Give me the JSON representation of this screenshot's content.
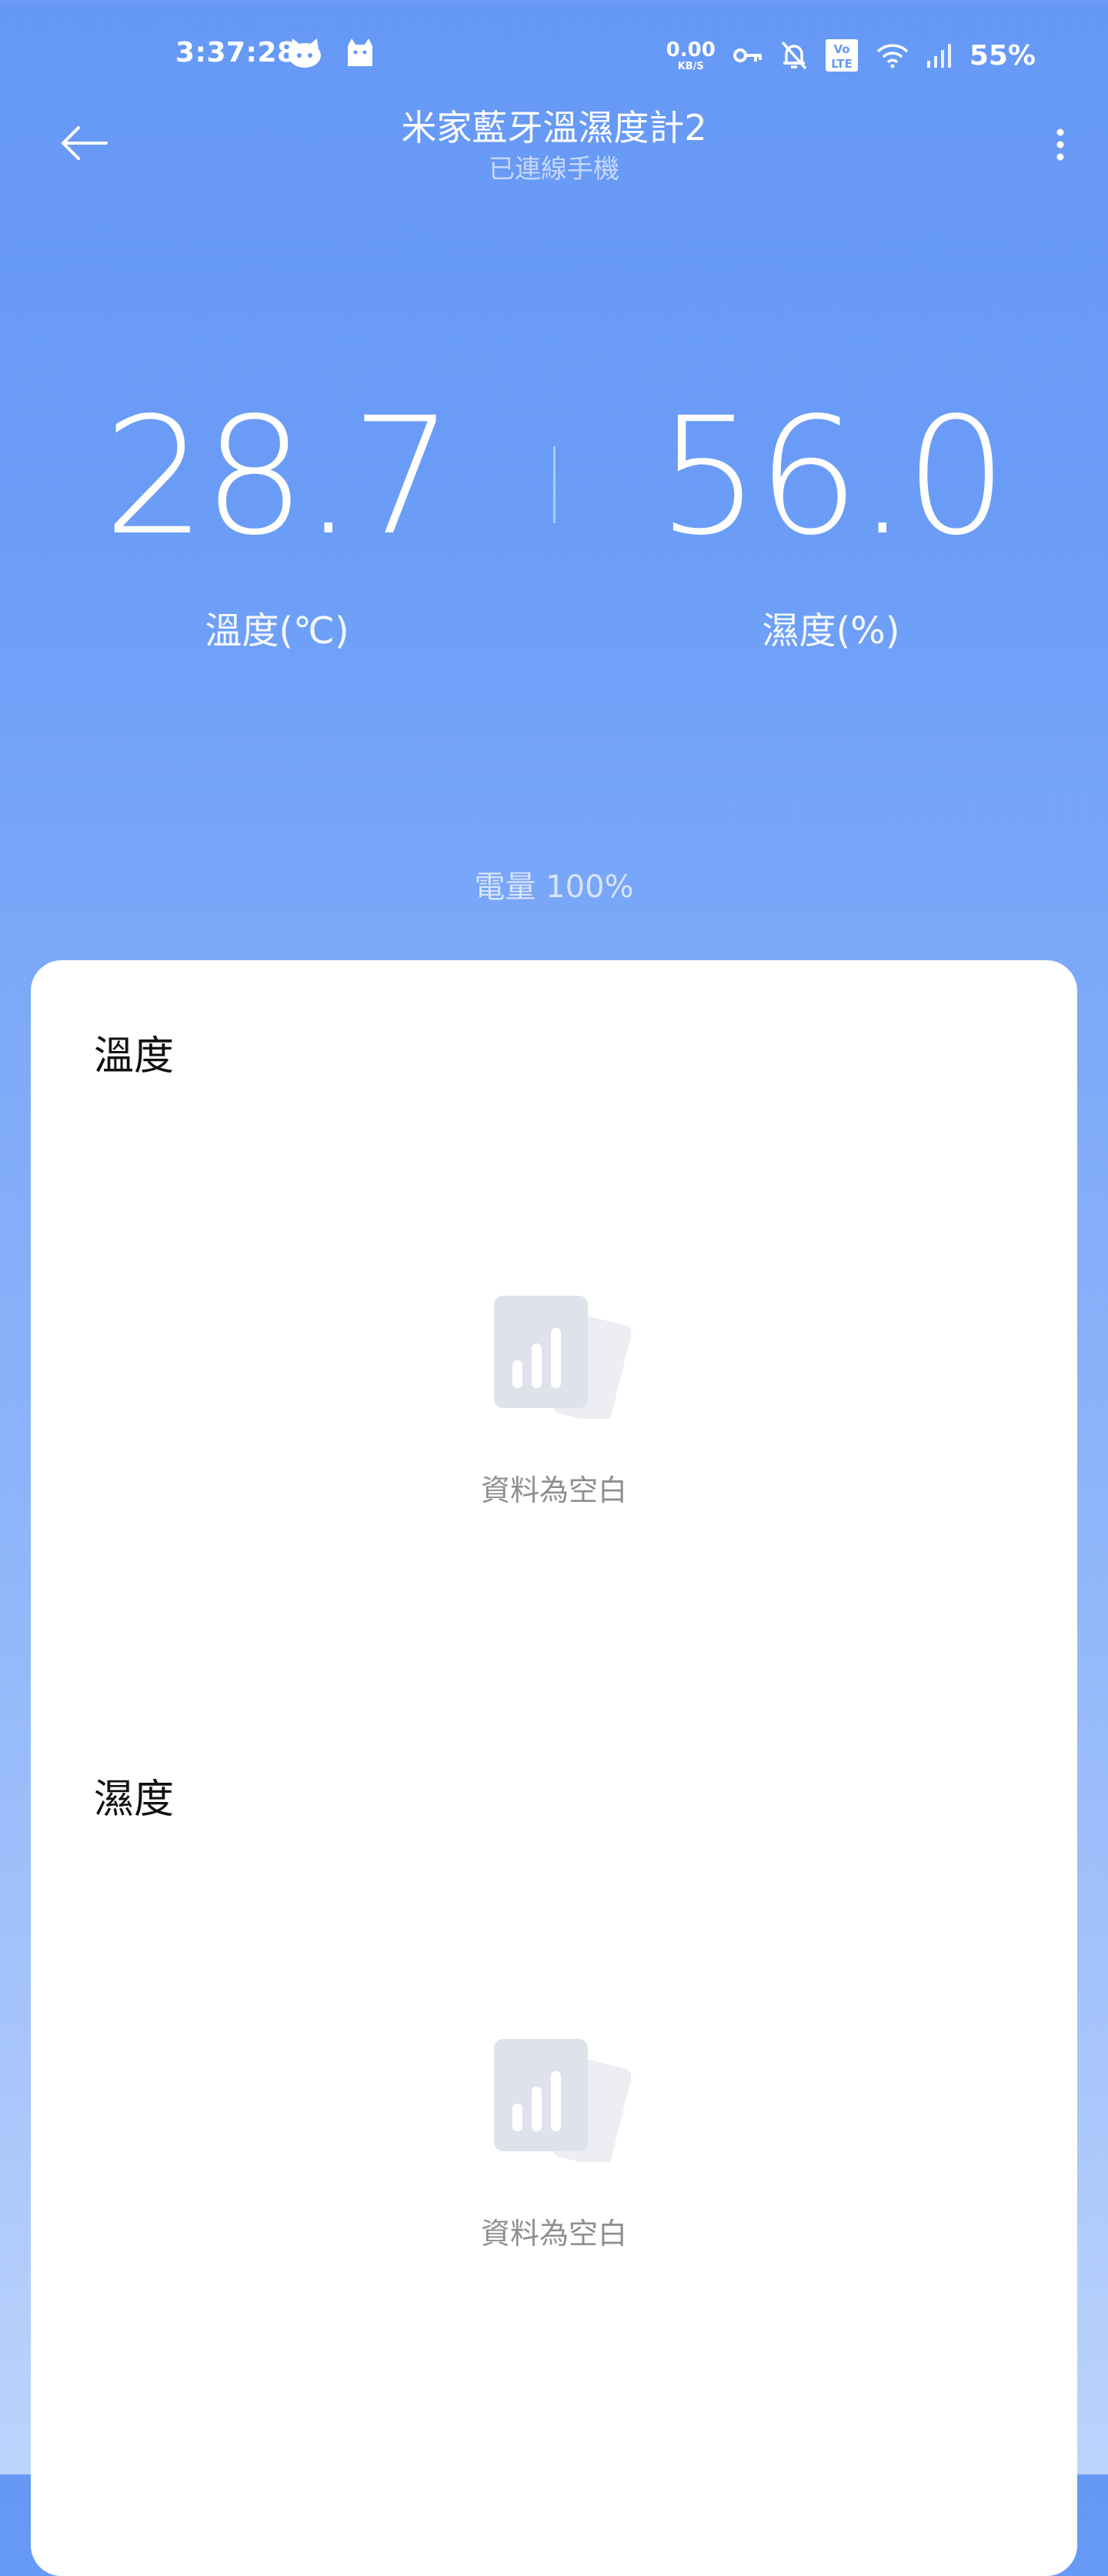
{
  "status_bar": {
    "time": "3:37:28",
    "net_speed_value": "0.00",
    "net_speed_unit": "KB/S",
    "battery": "55%",
    "icons": [
      "cat-app-icon",
      "cat-app-icon-2",
      "vpn-key-icon",
      "bell-off-icon",
      "volte-icon",
      "wifi-icon",
      "signal-icon"
    ]
  },
  "header": {
    "title": "米家藍牙溫濕度計2",
    "subtitle": "已連線手機"
  },
  "readings": {
    "temperature": {
      "value": "28.7",
      "label": "溫度(℃)"
    },
    "humidity": {
      "value": "56.0",
      "label": "濕度(%)"
    }
  },
  "battery_text": "電量 100%",
  "sections": [
    {
      "title": "溫度",
      "empty_text": "資料為空白"
    },
    {
      "title": "濕度",
      "empty_text": "資料為空白"
    }
  ],
  "colors": {
    "gradient_top": "#6699f6",
    "gradient_bottom": "#bcd4fc",
    "card_bg": "#ffffff",
    "empty_text": "#8e8e93"
  }
}
